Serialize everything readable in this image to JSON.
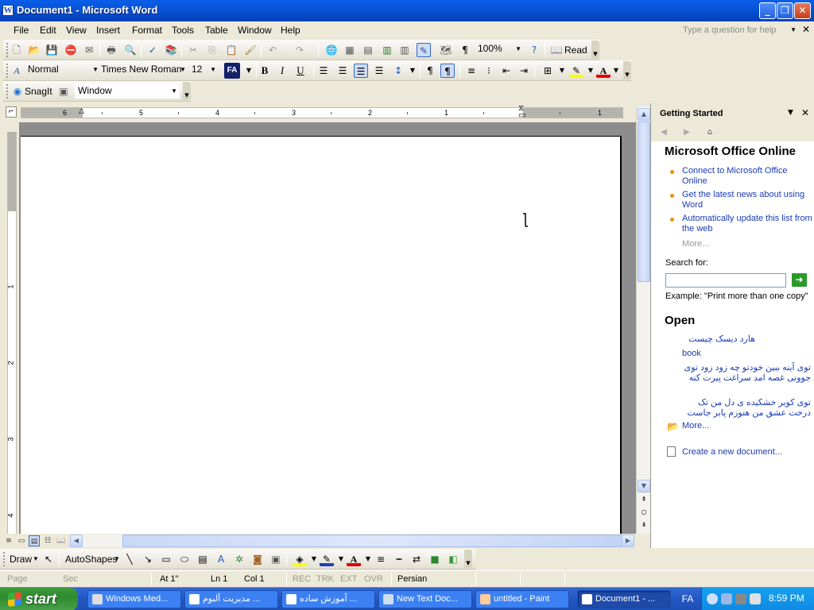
{
  "window": {
    "title": "Document1 - Microsoft Word",
    "app_icon": "W"
  },
  "menubar": {
    "items": [
      "File",
      "Edit",
      "View",
      "Insert",
      "Format",
      "Tools",
      "Table",
      "Window",
      "Help"
    ],
    "help_placeholder": "Type a question for help"
  },
  "standard_toolbar": {
    "zoom": "100%",
    "read_label": "Read"
  },
  "formatting_toolbar": {
    "style": "Normal",
    "font": "Times New Roman",
    "size": "12",
    "language_badge": "FA",
    "bold": "B",
    "italic": "I",
    "underline": "U"
  },
  "snagit_toolbar": {
    "snagit_label": "SnagIt",
    "capture_mode": "Window"
  },
  "ruler": {
    "horizontal_numbers": [
      "6",
      "5",
      "4",
      "3",
      "2",
      "1",
      "1"
    ],
    "vertical_numbers": [
      "1",
      "1",
      "2",
      "3",
      "4"
    ]
  },
  "task_pane": {
    "title": "Getting Started",
    "office_online_heading": "Microsoft Office Online",
    "links": [
      "Connect to Microsoft Office Online",
      "Get the latest news about using Word",
      "Automatically update this list from the web"
    ],
    "more_online": "More...",
    "search_label": "Search for:",
    "search_example": "Example:  \"Print more than one copy\"",
    "open_heading": "Open",
    "recent_files": [
      "هارد دیسک چیست",
      "book",
      "توی آینه ببین خودتو چه زود زود توی جوونی غصه امد سراغت پیرت کنه",
      "توی کویر خشکیده ی دل من     تک درخت عشق من هنوزم پابر جاست"
    ],
    "more_files": "More...",
    "create_new": "Create a new document..."
  },
  "drawing_toolbar": {
    "draw_label": "Draw",
    "autoshapes_label": "AutoShapes"
  },
  "statusbar": {
    "page": "Page",
    "sec": "Sec",
    "at": "At 1\"",
    "ln": "Ln 1",
    "col": "Col 1",
    "rec": "REC",
    "trk": "TRK",
    "ext": "EXT",
    "ovr": "OVR",
    "language": "Persian"
  },
  "taskbar": {
    "start_label": "start",
    "tasks": [
      "Windows Med...",
      "مدیریت آلبوم ...",
      "آموزش ساده ...",
      "New Text Doc...",
      "untitled - Paint",
      "Document1 - ..."
    ],
    "lang": "FA",
    "clock": "8:59 PM"
  },
  "colors": {
    "accent": "#0A5EE8",
    "link": "#1a3cb3",
    "bullet": "#f09000",
    "start": "#2f8a2f"
  }
}
